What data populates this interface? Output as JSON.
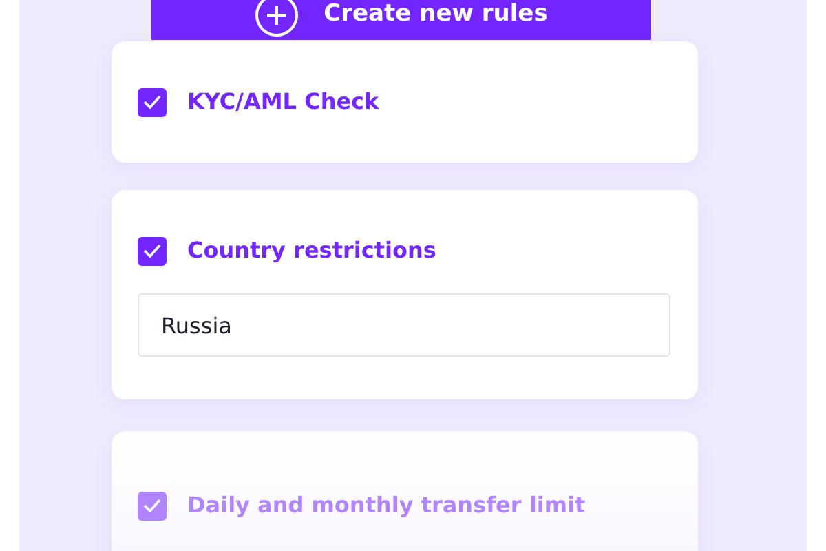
{
  "create_button": {
    "label": "Create new rules"
  },
  "rules": [
    {
      "kind": "check",
      "label": "KYC/AML Check",
      "checked": true,
      "dimmed": false
    },
    {
      "kind": "check-input",
      "label": "Country restrictions",
      "checked": true,
      "dimmed": false,
      "value": "Russia"
    },
    {
      "kind": "check",
      "label": "Daily and monthly transfer limit",
      "checked": true,
      "dimmed": true
    }
  ]
}
